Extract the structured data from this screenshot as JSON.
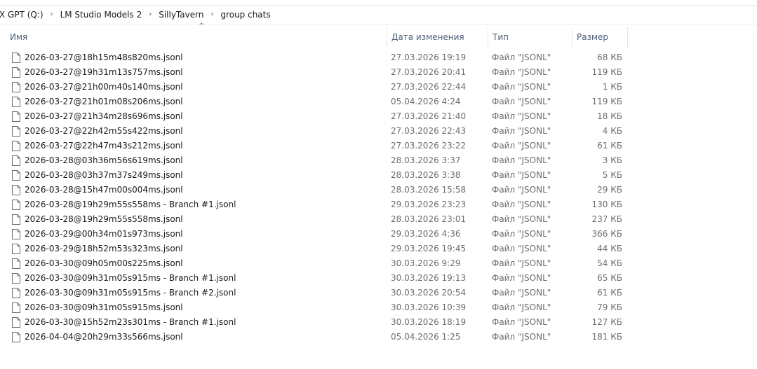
{
  "breadcrumb": [
    "X GPT (Q:)",
    "LM Studio Models 2",
    "SillyTavern",
    "group chats"
  ],
  "columns": {
    "name": "Имя",
    "date": "Дата изменения",
    "type": "Тип",
    "size": "Размер"
  },
  "sort_indicator": "^",
  "files": [
    {
      "name": "2026-03-27@18h15m48s820ms.jsonl",
      "date": "27.03.2026 19:19",
      "type": "Файл \"JSONL\"",
      "size": "68 КБ"
    },
    {
      "name": "2026-03-27@19h31m13s757ms.jsonl",
      "date": "27.03.2026 20:41",
      "type": "Файл \"JSONL\"",
      "size": "119 КБ"
    },
    {
      "name": "2026-03-27@21h00m40s140ms.jsonl",
      "date": "27.03.2026 22:44",
      "type": "Файл \"JSONL\"",
      "size": "1 КБ"
    },
    {
      "name": "2026-03-27@21h01m08s206ms.jsonl",
      "date": "05.04.2026 4:24",
      "type": "Файл \"JSONL\"",
      "size": "119 КБ"
    },
    {
      "name": "2026-03-27@21h34m28s696ms.jsonl",
      "date": "27.03.2026 21:40",
      "type": "Файл \"JSONL\"",
      "size": "18 КБ"
    },
    {
      "name": "2026-03-27@22h42m55s422ms.jsonl",
      "date": "27.03.2026 22:43",
      "type": "Файл \"JSONL\"",
      "size": "4 КБ"
    },
    {
      "name": "2026-03-27@22h47m43s212ms.jsonl",
      "date": "27.03.2026 23:22",
      "type": "Файл \"JSONL\"",
      "size": "61 КБ"
    },
    {
      "name": "2026-03-28@03h36m56s619ms.jsonl",
      "date": "28.03.2026 3:37",
      "type": "Файл \"JSONL\"",
      "size": "3 КБ"
    },
    {
      "name": "2026-03-28@03h37m37s249ms.jsonl",
      "date": "28.03.2026 3:38",
      "type": "Файл \"JSONL\"",
      "size": "5 КБ"
    },
    {
      "name": "2026-03-28@15h47m00s004ms.jsonl",
      "date": "28.03.2026 15:58",
      "type": "Файл \"JSONL\"",
      "size": "29 КБ"
    },
    {
      "name": "2026-03-28@19h29m55s558ms - Branch #1.jsonl",
      "date": "29.03.2026 23:23",
      "type": "Файл \"JSONL\"",
      "size": "130 КБ"
    },
    {
      "name": "2026-03-28@19h29m55s558ms.jsonl",
      "date": "28.03.2026 23:01",
      "type": "Файл \"JSONL\"",
      "size": "237 КБ"
    },
    {
      "name": "2026-03-29@00h34m01s973ms.jsonl",
      "date": "29.03.2026 4:36",
      "type": "Файл \"JSONL\"",
      "size": "366 КБ"
    },
    {
      "name": "2026-03-29@18h52m53s323ms.jsonl",
      "date": "29.03.2026 19:45",
      "type": "Файл \"JSONL\"",
      "size": "44 КБ"
    },
    {
      "name": "2026-03-30@09h05m00s225ms.jsonl",
      "date": "30.03.2026 9:29",
      "type": "Файл \"JSONL\"",
      "size": "54 КБ"
    },
    {
      "name": "2026-03-30@09h31m05s915ms - Branch #1.jsonl",
      "date": "30.03.2026 19:13",
      "type": "Файл \"JSONL\"",
      "size": "65 КБ"
    },
    {
      "name": "2026-03-30@09h31m05s915ms - Branch #2.jsonl",
      "date": "30.03.2026 20:54",
      "type": "Файл \"JSONL\"",
      "size": "61 КБ"
    },
    {
      "name": "2026-03-30@09h31m05s915ms.jsonl",
      "date": "30.03.2026 10:39",
      "type": "Файл \"JSONL\"",
      "size": "79 КБ"
    },
    {
      "name": "2026-03-30@15h52m23s301ms - Branch #1.jsonl",
      "date": "30.03.2026 18:19",
      "type": "Файл \"JSONL\"",
      "size": "127 КБ"
    },
    {
      "name": "2026-04-04@20h29m33s566ms.jsonl",
      "date": "05.04.2026 1:25",
      "type": "Файл \"JSONL\"",
      "size": "181 КБ"
    }
  ]
}
